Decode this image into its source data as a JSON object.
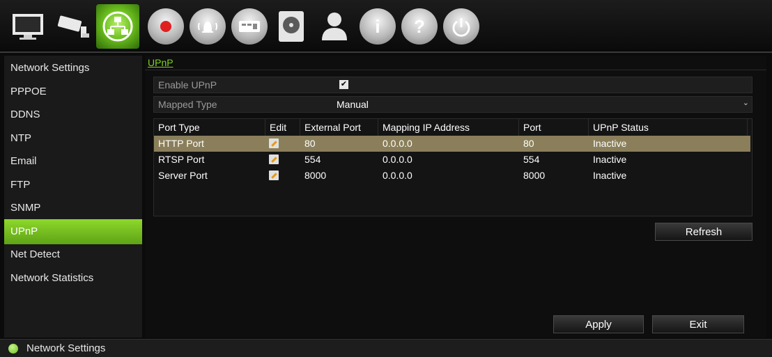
{
  "toolbar": {
    "icons": [
      "display-icon",
      "camera-icon",
      "network-icon",
      "record-icon",
      "alarm-icon",
      "device-icon",
      "storage-icon",
      "user-icon",
      "info-icon",
      "help-icon",
      "power-icon"
    ],
    "active": "network-icon",
    "glyphs": {
      "info": "i",
      "help": "?"
    }
  },
  "sidebar": {
    "items": [
      {
        "label": "Network Settings"
      },
      {
        "label": "PPPOE"
      },
      {
        "label": "DDNS"
      },
      {
        "label": "NTP"
      },
      {
        "label": "Email"
      },
      {
        "label": "FTP"
      },
      {
        "label": "SNMP"
      },
      {
        "label": "UPnP",
        "active": true
      },
      {
        "label": "Net Detect"
      },
      {
        "label": "Network Statistics"
      }
    ]
  },
  "main": {
    "breadcrumb": "UPnP",
    "enable_upnp": {
      "label": "Enable UPnP",
      "checked": true,
      "check_glyph": "✔"
    },
    "mapped_type": {
      "label": "Mapped Type",
      "value": "Manual",
      "caret": "⌄"
    },
    "table": {
      "headers": [
        "Port Type",
        "Edit",
        "External Port",
        "Mapping IP Address",
        "Port",
        "UPnP Status"
      ],
      "rows": [
        {
          "port_type": "HTTP Port",
          "external_port": "80",
          "ip": "0.0.0.0",
          "port": "80",
          "status": "Inactive",
          "selected": true
        },
        {
          "port_type": "RTSP Port",
          "external_port": "554",
          "ip": "0.0.0.0",
          "port": "554",
          "status": "Inactive"
        },
        {
          "port_type": "Server Port",
          "external_port": "8000",
          "ip": "0.0.0.0",
          "port": "8000",
          "status": "Inactive"
        }
      ]
    },
    "refresh_label": "Refresh",
    "apply_label": "Apply",
    "exit_label": "Exit"
  },
  "status": {
    "text": "Network Settings"
  },
  "colors": {
    "accent": "#7ed321",
    "selected_row": "#8a7f5a"
  }
}
